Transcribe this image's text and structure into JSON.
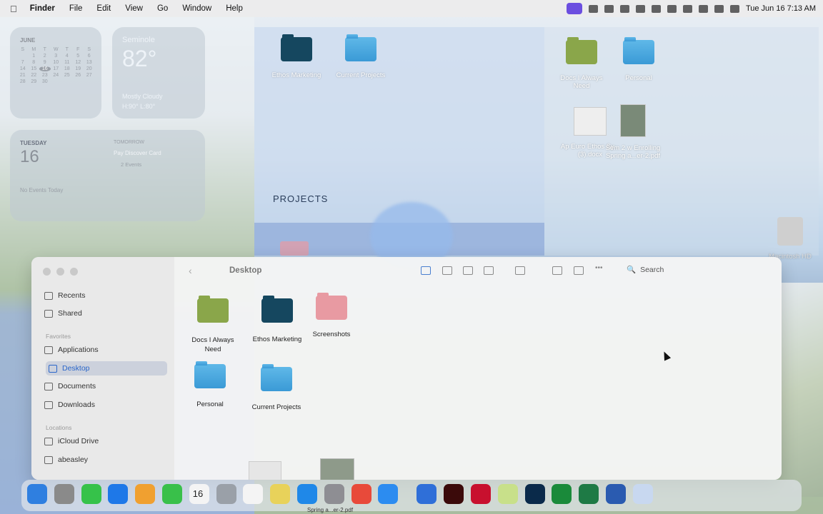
{
  "menubar": {
    "app_name": "Finder",
    "items": [
      "File",
      "Edit",
      "View",
      "Go",
      "Window",
      "Help"
    ],
    "clock": "Tue Jun 16  7:13 AM"
  },
  "widgets": {
    "calendar": {
      "month": "JUNE",
      "weekdays": [
        "S",
        "M",
        "T",
        "W",
        "T",
        "F",
        "S"
      ],
      "days": [
        "",
        "1",
        "2",
        "3",
        "4",
        "5",
        "6",
        "7",
        "8",
        "9",
        "10",
        "11",
        "12",
        "13",
        "14",
        "15",
        "16",
        "17",
        "18",
        "19",
        "20",
        "21",
        "22",
        "23",
        "24",
        "25",
        "26",
        "27",
        "28",
        "29",
        "30"
      ],
      "today": "16"
    },
    "weather": {
      "city": "Seminole",
      "temp": "82°",
      "condition": "Mostly Cloudy",
      "hilo": "H:90° L:80°"
    },
    "events": {
      "day_label": "TUESDAY",
      "day_num": "16",
      "no_events": "No Events Today",
      "tomorrow": "TOMORROW",
      "event1": "Pay Discover Card",
      "event2": "2 Events"
    }
  },
  "desktop": {
    "projects_title": "PROJECTS",
    "top_items": [
      {
        "label": "Ethos Marketing"
      },
      {
        "label": "Current Projects"
      }
    ],
    "right_items": [
      {
        "label": "Docs I Always Need"
      },
      {
        "label": "Personal"
      },
      {
        "label": "Ap Euro Ethos Sy...(3).docx"
      },
      {
        "label": "Sem 2 w Enrolling Spring a...er-2.pdf"
      }
    ],
    "drive_label": "Macintosh HD"
  },
  "finder": {
    "title": "Desktop",
    "search_label": "Search",
    "sidebar": {
      "recents": "Recents",
      "shared": "Shared",
      "favorites_header": "Favorites",
      "applications": "Applications",
      "desktop": "Desktop",
      "documents": "Documents",
      "downloads": "Downloads",
      "locations_header": "Locations",
      "icloud": "iCloud Drive",
      "user": "abeasley"
    },
    "items": [
      {
        "label": "Docs I Always Need",
        "color": "#8aa64a"
      },
      {
        "label": "Ethos Marketing",
        "color": "#15475f"
      },
      {
        "label": "Screenshots",
        "color": "#e89aa2"
      },
      {
        "label": "Personal",
        "color": "#3a9ad6"
      },
      {
        "label": "Current Projects",
        "color": "#3a9ad6"
      }
    ]
  },
  "dock": {
    "today_date": "16",
    "bottom_label": "Spring a...er-2.pdf"
  }
}
